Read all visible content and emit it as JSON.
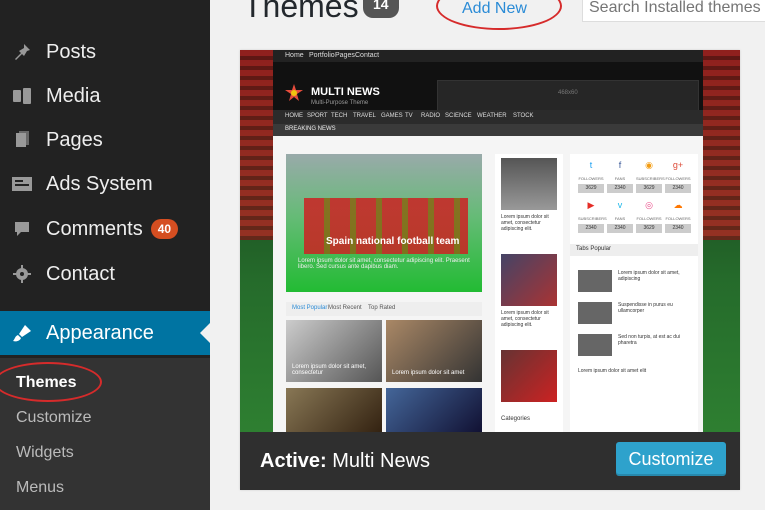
{
  "header": {
    "title": "Themes",
    "count": "14",
    "add_new": "Add New",
    "search_placeholder": "Search Installed themes"
  },
  "sidebar": {
    "items": [
      {
        "label": "Posts",
        "icon": "pin-icon"
      },
      {
        "label": "Media",
        "icon": "media-icon"
      },
      {
        "label": "Pages",
        "icon": "pages-icon"
      },
      {
        "label": "Ads System",
        "icon": "ads-icon"
      },
      {
        "label": "Comments",
        "icon": "comments-icon",
        "badge": "40"
      },
      {
        "label": "Contact",
        "icon": "gear-icon"
      },
      {
        "label": "Appearance",
        "icon": "brush-icon",
        "active": true
      }
    ],
    "submenu": [
      "Themes",
      "Customize",
      "Widgets",
      "Menus"
    ]
  },
  "theme_card": {
    "active_prefix": "Active:",
    "active_name": "Multi News",
    "customize_label": "Customize",
    "preview": {
      "nav": [
        "Home",
        "Portfolio",
        "Pages",
        "Contact"
      ],
      "brand": "MULTI NEWS",
      "brand_sub": "Multi-Purpose Theme",
      "ad_text": "468x60",
      "menu": [
        "HOME",
        "SPORT",
        "TECH",
        "TRAVEL",
        "GAMES",
        "TV",
        "RADIO",
        "SCIENCE",
        "WEATHER",
        "STOCK"
      ],
      "breaking": "BREAKING NEWS",
      "feature_caption": "Spain national football team",
      "feature_desc": "Lorem ipsum dolor sit amet, consectetur adipiscing elit. Praesent libero. Sed cursus ante dapibus diam.",
      "tabs": [
        "Most Popular",
        "Most Recent",
        "Top Rated"
      ],
      "thumbs": [
        "Lorem ipsum dolor sit amet, consectetur",
        "Lorem ipsum dolor sit amet",
        "",
        ""
      ],
      "col2_text": "Lorem ipsum dolor sit amet, consectetur adipiscing elit.",
      "col2_categories": "Categories",
      "social": [
        {
          "icon": "twitter-icon",
          "label": "FOLLOWERS",
          "count": "3629"
        },
        {
          "icon": "facebook-icon",
          "label": "FANS",
          "count": "2340"
        },
        {
          "icon": "rss-icon",
          "label": "SUBSCRIBERS",
          "count": "3629"
        },
        {
          "icon": "googleplus-icon",
          "label": "FOLLOWERS",
          "count": "2340"
        },
        {
          "icon": "youtube-icon",
          "label": "SUBSCRIBERS",
          "count": "2340"
        },
        {
          "icon": "vimeo-icon",
          "label": "FANS",
          "count": "2340"
        },
        {
          "icon": "dribbble-icon",
          "label": "FOLLOWERS",
          "count": "3629"
        },
        {
          "icon": "soundcloud-icon",
          "label": "FOLLOWERS",
          "count": "2340"
        }
      ],
      "popular_tab": "Tabs Popular",
      "popular_rows": [
        "Lorem ipsum dolor sit amet, adipiscing",
        "Suspendisse in purus eu ullamcorper",
        "Sed non turpis, at est ac dui pharetra",
        "Lorem ipsum dolor sit amet elit"
      ]
    }
  }
}
